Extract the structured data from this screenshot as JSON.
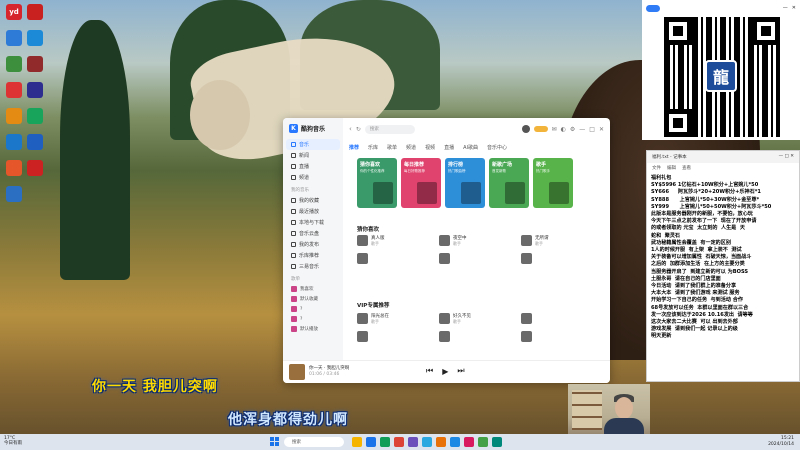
{
  "desktop": {
    "icons": [
      {
        "label": "yd",
        "color": "#d7252d"
      },
      {
        "label": "",
        "color": "#2d7bd6"
      },
      {
        "label": "",
        "color": "#3d8f3d"
      },
      {
        "label": "",
        "color": "#d33"
      },
      {
        "label": "",
        "color": "#e38b12"
      },
      {
        "label": "",
        "color": "#1b77c9"
      },
      {
        "label": "",
        "color": "#e5572a"
      },
      {
        "label": "",
        "color": "#2a6fc2"
      },
      {
        "label": "",
        "color": "#c92020"
      },
      {
        "label": "",
        "color": "#1c8ad6"
      },
      {
        "label": "",
        "color": "#912b2b"
      },
      {
        "label": "",
        "color": "#2d2d8f"
      },
      {
        "label": "",
        "color": "#18a45a"
      },
      {
        "label": "",
        "color": "#1f5fbf"
      },
      {
        "label": "",
        "color": "#cc2222"
      }
    ]
  },
  "music_app": {
    "logo": "酷狗音乐",
    "search_placeholder": "搜索",
    "nav": [
      "音乐",
      "新闻",
      "直播",
      "频道"
    ],
    "nav_head": "我的音乐",
    "my_items": [
      "我的收藏",
      "最近播放",
      "本地与下载",
      "音乐云盘",
      "我的发布",
      "乐库推荐",
      "三易音乐"
    ],
    "playlist_head": "歌单",
    "playlists": [
      "我喜欢",
      "默认收藏",
      "?",
      "?",
      "默认播放"
    ],
    "tabs": [
      "推荐",
      "乐库",
      "歌单",
      "频道",
      "视频",
      "直播",
      "AI歌曲",
      "音乐中心"
    ],
    "cards": [
      {
        "title": "猜你喜欢",
        "sub": "你的个性化推荐",
        "color": "#3a9a6a"
      },
      {
        "title": "每日推荐",
        "sub": "每日好歌推荐",
        "color": "#e0436e"
      },
      {
        "title": "排行榜",
        "sub": "热门歌曲榜",
        "color": "#2e8fd9"
      },
      {
        "title": "新歌广场",
        "sub": "首发新歌",
        "color": "#4aa854"
      },
      {
        "title": "歌手",
        "sub": "热门歌手",
        "color": "#57b34a"
      }
    ],
    "sec1_title": "猜你喜欢",
    "sec2_title": "VIP专属推荐",
    "songs1": [
      {
        "t": "真人版",
        "a": "歌手"
      },
      {
        "t": "夜空中",
        "a": "歌手"
      },
      {
        "t": "无所谓",
        "a": "歌手"
      },
      {
        "t": "",
        "a": ""
      },
      {
        "t": "",
        "a": ""
      },
      {
        "t": "",
        "a": ""
      }
    ],
    "songs2": [
      {
        "t": "阳光总在",
        "a": "歌手"
      },
      {
        "t": "好久不见",
        "a": "歌手"
      },
      {
        "t": "",
        "a": ""
      },
      {
        "t": "",
        "a": ""
      },
      {
        "t": "",
        "a": ""
      },
      {
        "t": "",
        "a": ""
      }
    ],
    "player": {
      "title": "你一天 · 我胆儿突啊",
      "time": "01:06 / 03:46"
    }
  },
  "notepad": {
    "title": "福利.txt - 记事本",
    "menu": [
      "文件",
      "编辑",
      "查看"
    ],
    "lines": [
      "福利礼包",
      "SY$5996 1亿钻石+10W积分+上官婉儿*50",
      "SY666     阿瓦莎斗*20+20W积分+乐神石*1",
      "SY888      上官婉儿*50+30W积分+金至尊*",
      "SY999      上官婉儿*50+50W积分+阿瓦莎斗*50",
      "此版本是服务器刚开的新服，不要怕，放心玩",
      "今天下午三点之前发布了一下  现在了开放申请",
      "的或者领取的 元宝  太立刻的  人生是  天",
      "蛇和  聚灵石",
      "武功秘籍属性会覆盖  有一定的区别",
      "1人的时候开服  有上架  拿上装不  测试",
      "关于装备可以增加属性  石破天惊，当面战斗",
      "之后的  加群添加生活  在上方的主要分类",
      "当服务器开启了  到建立新的可以 为BOSS",
      "土服永哥  请在自己的门店里面",
      "今日活动  请到了我们群上的准备分享",
      "大本大本  请到了我们游戏 来测试 服务",
      "开始学习一下自己的任务  与到活动 合作",
      "68号发放可以任务  本群以里面在群以三合",
      "发一次应该到达于2026 10.16发出  请等等",
      "这次大家去二大比赛  可以 出到去外部",
      "游戏发展  请到我们一起 记录以上的级",
      "明天更新"
    ]
  },
  "lyrics": {
    "line1": "你一天  我胆儿突啊",
    "line2": "他浑身都得劲儿啊"
  },
  "taskbar": {
    "weather_temp": "17°C",
    "weather_desc": "今日有雨",
    "search": "搜索",
    "time": "15:21",
    "date": "2024/10/14"
  }
}
